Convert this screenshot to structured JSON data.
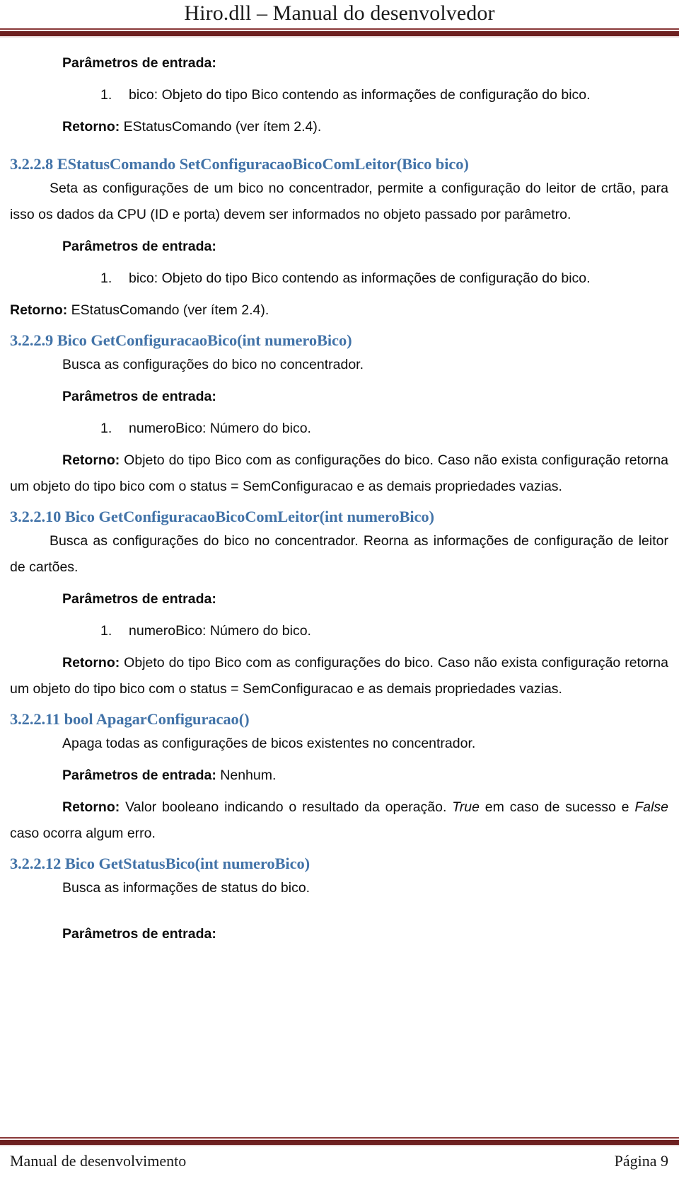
{
  "header": {
    "title": "Hiro.dll – Manual do desenvolvedor"
  },
  "footer": {
    "left": "Manual de desenvolvimento",
    "right": "Página 9"
  },
  "labels": {
    "parametros": "Parâmetros de entrada:",
    "parametros_inline": "Parâmetros de entrada",
    "retorno": "Retorno:",
    "retorno_inline": "Retorno"
  },
  "blocks": {
    "top_params_label": "Parâmetros de entrada:",
    "top_list": [
      {
        "num": "1.",
        "text": "bico: Objeto do tipo Bico contendo as informações de configuração do bico."
      }
    ],
    "top_retorno_label": "Retorno:",
    "top_retorno_text": " EStatusComando (ver ítem 2.4)."
  },
  "sections": [
    {
      "id": "3.2.2.8",
      "heading": "3.2.2.8 EStatusComando SetConfiguracaoBicoComLeitor(Bico bico)",
      "body": "Seta as configurações de um bico no concentrador, permite a configuração do leitor de crtão, para isso os dados da CPU (ID e porta) devem ser informados no objeto passado por parâmetro.",
      "params_label": "Parâmetros de entrada:",
      "params": [
        {
          "num": "1.",
          "text": "bico: Objeto do tipo Bico contendo as informações de configuração do bico."
        }
      ],
      "retorno_label": "Retorno:",
      "retorno_text": " EStatusComando (ver ítem 2.4)."
    },
    {
      "id": "3.2.2.9",
      "heading": "3.2.2.9 Bico GetConfiguracaoBico(int numeroBico)",
      "body": "Busca as configurações do bico no concentrador.",
      "params_label": "Parâmetros de entrada:",
      "params": [
        {
          "num": "1.",
          "text": "numeroBico: Número do bico."
        }
      ],
      "retorno_label": "Retorno:",
      "retorno_text": " Objeto do tipo Bico com as configurações do bico. Caso não exista configuração retorna um objeto do tipo bico com o status = SemConfiguracao e as demais propriedades vazias."
    },
    {
      "id": "3.2.2.10",
      "heading": "3.2.2.10 Bico GetConfiguracaoBicoComLeitor(int numeroBico)",
      "body": "Busca as configurações do bico no concentrador. Reorna as informações de configuração de leitor de cartões.",
      "params_label": "Parâmetros de entrada:",
      "params": [
        {
          "num": "1.",
          "text": "numeroBico: Número do bico."
        }
      ],
      "retorno_label": "Retorno:",
      "retorno_text": " Objeto do tipo Bico com as configurações do bico. Caso não exista configuração retorna um objeto do tipo bico com o status = SemConfiguracao e as demais propriedades vazias."
    },
    {
      "id": "3.2.2.11",
      "heading": "3.2.2.11 bool ApagarConfiguracao()",
      "body": "Apaga todas as configurações de bicos existentes no concentrador.",
      "params_label": "Parâmetros de entrada:",
      "params_inline_value": " Nenhum.",
      "retorno_label": "Retorno:",
      "retorno_pre": " Valor booleano indicando o resultado da operação. ",
      "retorno_italic_1": "True",
      "retorno_mid": " em caso de sucesso e ",
      "retorno_italic_2": "False",
      "retorno_post": " caso ocorra algum erro."
    },
    {
      "id": "3.2.2.12",
      "heading": "3.2.2.12 Bico GetStatusBico(int numeroBico)",
      "body": "Busca as informações de status do bico.",
      "params_label": "Parâmetros de entrada:"
    }
  ],
  "colors": {
    "heading_blue": "#4273a8",
    "rule_maroon": "#6d2020",
    "rule_thin": "#8a3a3a",
    "text": "#0d0d0d"
  }
}
